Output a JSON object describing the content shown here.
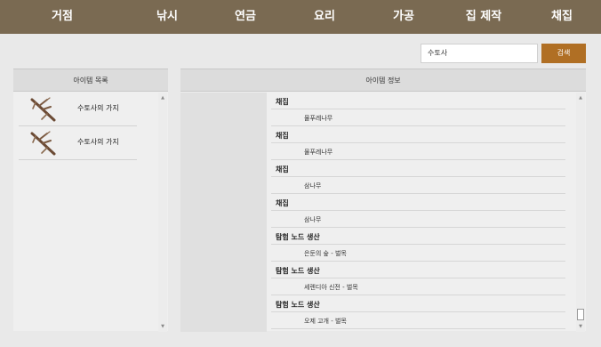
{
  "nav": {
    "items": [
      "거점",
      "낚시",
      "연금",
      "요리",
      "가공",
      "집 제작",
      "채집"
    ]
  },
  "search": {
    "value": "수토사",
    "button_label": "검색"
  },
  "item_list": {
    "header": "아이템 목록",
    "items": [
      {
        "label": "수토사의 가지",
        "icon": "branch-icon"
      },
      {
        "label": "수토사의 가지",
        "icon": "branch-icon"
      }
    ]
  },
  "item_info": {
    "header": "아이템 정보",
    "rows": [
      {
        "type": "head",
        "text": "채집"
      },
      {
        "type": "sub",
        "text": "물푸레나무"
      },
      {
        "type": "head",
        "text": "채집"
      },
      {
        "type": "sub",
        "text": "물푸레나무"
      },
      {
        "type": "head",
        "text": "채집"
      },
      {
        "type": "sub",
        "text": "삼나무"
      },
      {
        "type": "head",
        "text": "채집"
      },
      {
        "type": "sub",
        "text": "삼나무"
      },
      {
        "type": "head",
        "text": "탐험 노드 생산"
      },
      {
        "type": "sub",
        "text": "은둔의 숲 - 벌목"
      },
      {
        "type": "head",
        "text": "탐험 노드 생산"
      },
      {
        "type": "sub",
        "text": "세렌디아 신전 - 벌목"
      },
      {
        "type": "head",
        "text": "탐험 노드 생산"
      },
      {
        "type": "sub",
        "text": "오제 고개 - 벌목"
      }
    ]
  },
  "colors": {
    "nav_bg": "#7a6a52",
    "search_button": "#b06f24"
  }
}
